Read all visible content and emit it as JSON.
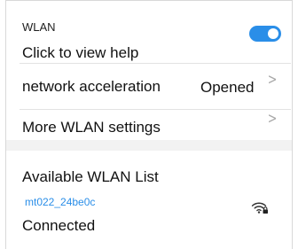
{
  "wlan": {
    "title": "WLAN",
    "help_text": "Click to view help",
    "enabled": true,
    "accent_color": "#2a8ee8"
  },
  "acceleration": {
    "label": "network acceleration",
    "value": "Opened",
    "chevron": ">"
  },
  "more_settings": {
    "label": "More WLAN settings",
    "chevron": ">"
  },
  "available": {
    "title": "Available WLAN List",
    "network": {
      "ssid": "mt022_24be0c",
      "status": "Connected",
      "icon": "wifi-locked-icon"
    }
  }
}
